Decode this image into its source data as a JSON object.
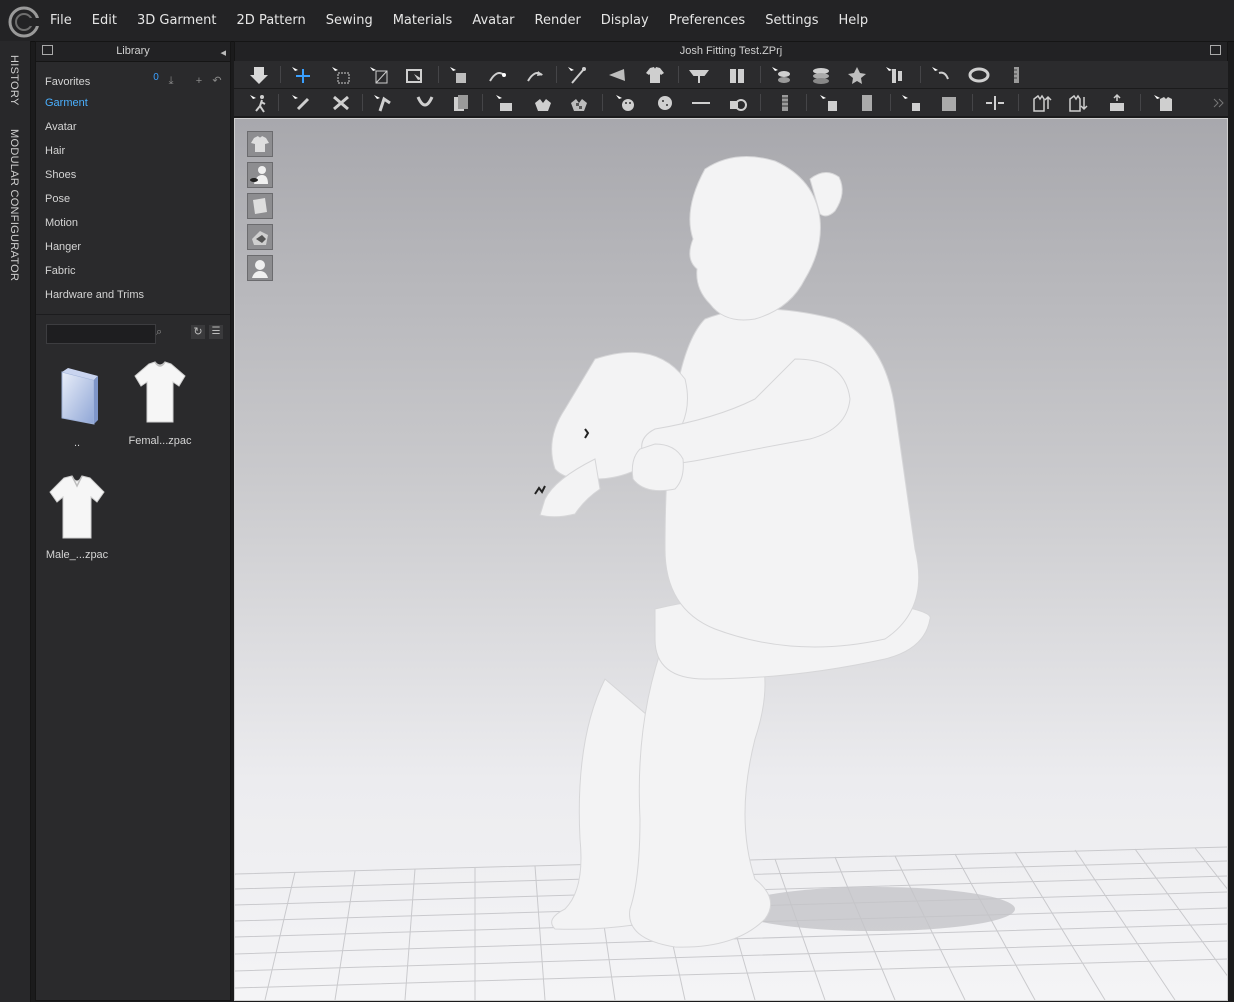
{
  "menubar": {
    "items": [
      "File",
      "Edit",
      "3D Garment",
      "2D Pattern",
      "Sewing",
      "Materials",
      "Avatar",
      "Render",
      "Display",
      "Preferences",
      "Settings",
      "Help"
    ]
  },
  "side_tabs": {
    "history": "HISTORY",
    "modular": "MODULAR CONFIGURATOR"
  },
  "library": {
    "title": "Library",
    "favorites": "Favorites",
    "badge": "0",
    "categories": [
      "Garment",
      "Avatar",
      "Hair",
      "Shoes",
      "Pose",
      "Motion",
      "Hanger",
      "Fabric",
      "Hardware and Trims"
    ],
    "active_category": "Garment",
    "search_placeholder": "",
    "items": [
      {
        "label": "..",
        "icon": "folder-icon"
      },
      {
        "label": "Femal...zpac",
        "icon": "tshirt-icon"
      },
      {
        "label": "Male_...zpac",
        "icon": "tshirt-icon"
      }
    ]
  },
  "viewport": {
    "title": "Josh Fitting Test.ZPrj"
  },
  "colors": {
    "accent": "#4ab0ff",
    "panel": "#2a2a2c",
    "menubar": "#232325"
  }
}
